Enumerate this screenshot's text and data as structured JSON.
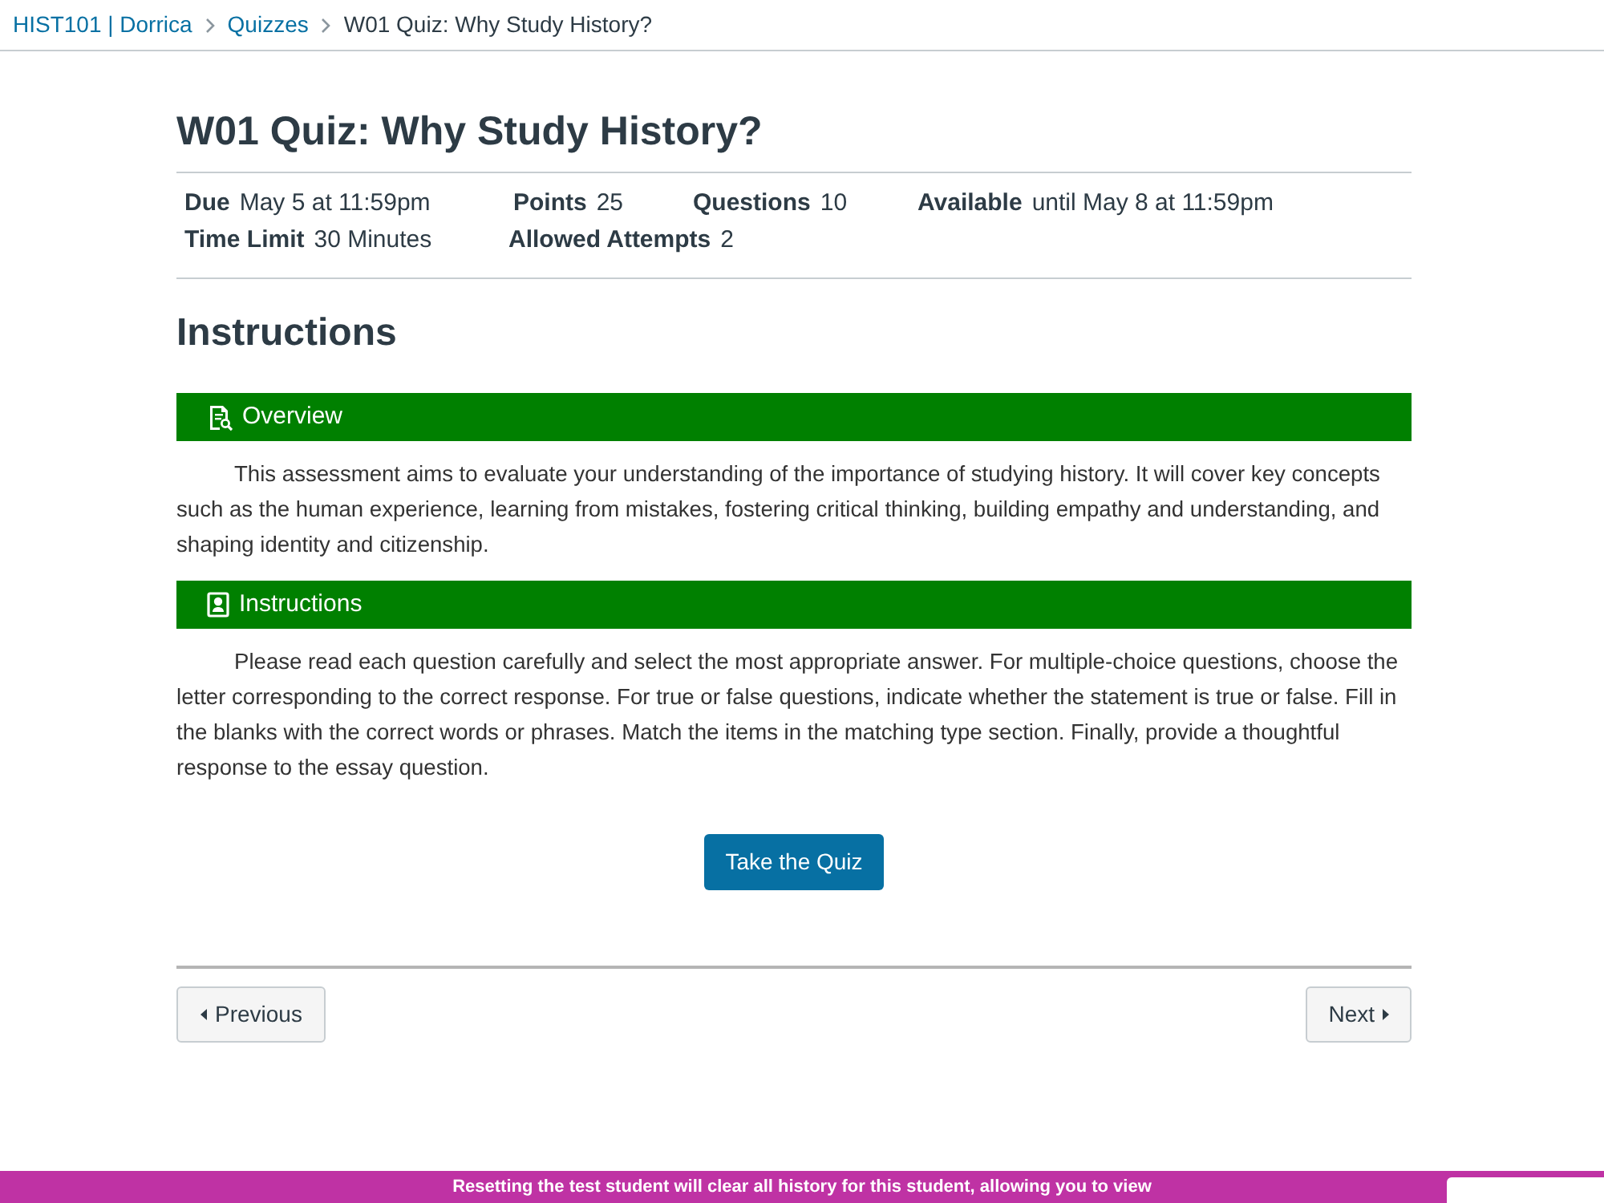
{
  "breadcrumb": [
    {
      "label": "HIST101 | Dorrica",
      "kind": "link"
    },
    {
      "label": "Quizzes",
      "kind": "link"
    },
    {
      "label": "W01 Quiz: Why Study History?",
      "kind": "current"
    }
  ],
  "quiz": {
    "title": "W01 Quiz: Why Study History?",
    "details": [
      [
        {
          "label": "Due",
          "value": "May 5 at 11:59pm"
        },
        {
          "label": "Points",
          "value": "25"
        },
        {
          "label": "Questions",
          "value": "10"
        },
        {
          "label": "Available",
          "value": "until May 8 at 11:59pm"
        }
      ],
      [
        {
          "label": "Time Limit",
          "value": "30 Minutes"
        },
        {
          "label": "Allowed Attempts",
          "value": "2"
        }
      ]
    ]
  },
  "instructions": {
    "heading": "Instructions",
    "sections": [
      {
        "title": "Overview",
        "text": "This assessment aims to evaluate your understanding of the importance of studying history. It will cover key concepts such as the human experience, learning from mistakes, fostering critical thinking, building empathy and understanding, and shaping identity and citizenship."
      },
      {
        "title": "Instructions",
        "text": "Please read each question carefully and select the most appropriate answer. For multiple-choice questions, choose the letter corresponding to the correct response. For true or false questions, indicate whether the statement is true or false. Fill in the blanks with the correct words or phrases. Match the items in the matching type section. Finally, provide a thoughtful response to the essay question."
      }
    ]
  },
  "take_quiz_button": "Take the Quiz",
  "pager": {
    "previous": "Previous",
    "next": "Next"
  },
  "student_view_bar": {
    "message": "Resetting the test student will clear all history for this student, allowing you to view"
  }
}
